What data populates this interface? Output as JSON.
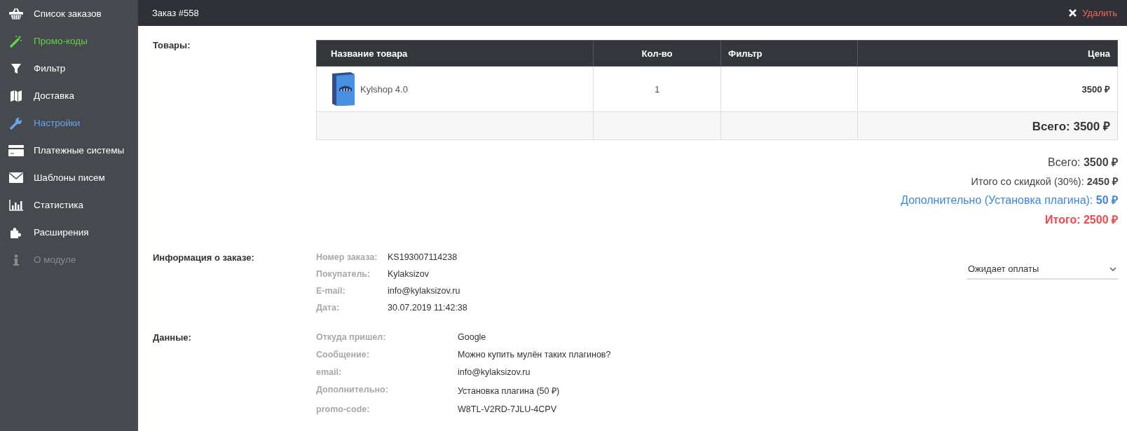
{
  "sidebar": {
    "items": [
      {
        "label": "Список заказов",
        "color": "#ffffff"
      },
      {
        "label": "Промо-коды",
        "color": "#62d14a"
      },
      {
        "label": "Фильтр",
        "color": "#ffffff"
      },
      {
        "label": "Доставка",
        "color": "#ffffff"
      },
      {
        "label": "Настройки",
        "color": "#6aa4ea"
      },
      {
        "label": "Платежные системы",
        "color": "#ffffff"
      },
      {
        "label": "Шаблоны писем",
        "color": "#ffffff"
      },
      {
        "label": "Статистика",
        "color": "#ffffff"
      },
      {
        "label": "Расширения",
        "color": "#ffffff"
      },
      {
        "label": "О модуле",
        "color": "#8a8c90"
      }
    ]
  },
  "header": {
    "title": "Заказ #558",
    "delete_label": "Удалить"
  },
  "products": {
    "label": "Товары:",
    "table": {
      "columns": [
        "Название товара",
        "Кол-во",
        "Фильтр",
        "Цена"
      ],
      "rows": [
        {
          "name": "Kylshop 4.0",
          "quantity": "1",
          "filter": "",
          "price": "3500 ₽"
        }
      ],
      "footer_total": "Всего: 3500 ₽"
    },
    "summary": [
      {
        "kind": "total",
        "text": "Всего: **3500 ₽**"
      },
      {
        "kind": "discount",
        "text": "Итого со скидкой (30%): **2450 ₽**"
      },
      {
        "kind": "extra",
        "text": "Дополнительно (Установка плагина): **50 ₽**"
      },
      {
        "kind": "grand",
        "text": "Итого: 2500 ₽"
      }
    ]
  },
  "order_info": {
    "label": "Информация о заказе:",
    "fields": [
      {
        "label": "Номер заказа:",
        "value": "KS193007114238"
      },
      {
        "label": "Покупатель:",
        "value": "Kylaksizov"
      },
      {
        "label": "E-mail:",
        "value": "info@kylaksizov.ru"
      },
      {
        "label": "Дата:",
        "value": "30.07.2019 11:42:38"
      }
    ],
    "status": "Ожидает оплаты"
  },
  "data": {
    "label": "Данные:",
    "fields": [
      {
        "label": "Откуда пришел:",
        "value": "Google"
      },
      {
        "label": "Сообщение:",
        "value": "Можно купить мулён таких плагинов?"
      },
      {
        "label": "email:",
        "value": "info@kylaksizov.ru"
      },
      {
        "label": "Дополнительно:",
        "value": "Установка плагина (50 ₽)"
      },
      {
        "label": "promo-code:",
        "value": "W8TL-V2RD-7JLU-4CPV"
      }
    ]
  }
}
